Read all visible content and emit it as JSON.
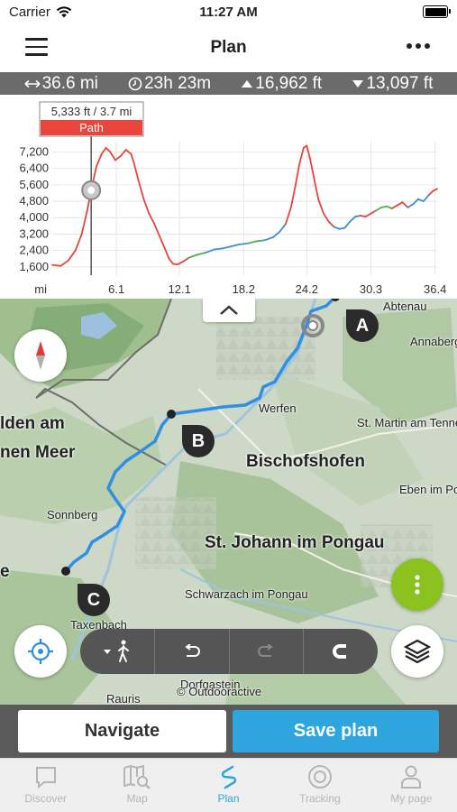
{
  "status": {
    "carrier": "Carrier",
    "time": "11:27 AM"
  },
  "nav": {
    "title": "Plan"
  },
  "stats": {
    "distance": "36.6 mi",
    "duration": "23h 23m",
    "ascent": "16,962 ft",
    "descent": "13,097 ft"
  },
  "chart_data": {
    "type": "line",
    "title": "",
    "xlabel": "mi",
    "ylabel": "ft",
    "xlim": [
      0,
      36.6
    ],
    "ylim": [
      1200,
      7700
    ],
    "x_ticks": [
      "6.1",
      "12.1",
      "18.2",
      "24.2",
      "30.3",
      "36.4"
    ],
    "y_ticks": [
      "7,200",
      "6,400",
      "5,600",
      "4,800",
      "4,000",
      "3,200",
      "2,400",
      "1,600"
    ],
    "series": [
      {
        "x": [
          0,
          0.8,
          1.5,
          2.2,
          2.8,
          3.3,
          3.7,
          4.2,
          4.7,
          5.1,
          5.5,
          6.0,
          6.5,
          7.0,
          7.5,
          7.8,
          8.2,
          8.7,
          9.2,
          9.7,
          10.2,
          10.7,
          11.1,
          11.5,
          11.9,
          12.4,
          13.0,
          13.8,
          14.6,
          15.4,
          16.2,
          17.0,
          17.8,
          18.6,
          19.4,
          20.2,
          21.0,
          21.6,
          22.2,
          22.7,
          23.1,
          23.5,
          23.9,
          24.2,
          24.5,
          24.9,
          25.3,
          25.8,
          26.3,
          26.8,
          27.3,
          27.8,
          28.3,
          28.8,
          29.3,
          29.8,
          30.3,
          30.8,
          31.3,
          31.8,
          32.3,
          32.8,
          33.3,
          33.8,
          34.3,
          34.8,
          35.3,
          35.8,
          36.2,
          36.6
        ],
        "y": [
          1700,
          1650,
          1900,
          2400,
          3200,
          4300,
          5333,
          6500,
          7100,
          7400,
          7200,
          6800,
          7000,
          7300,
          7100,
          6600,
          5800,
          4900,
          4200,
          3700,
          3100,
          2500,
          2000,
          1750,
          1720,
          1850,
          2050,
          2200,
          2300,
          2450,
          2500,
          2600,
          2700,
          2750,
          2850,
          2900,
          3050,
          3300,
          3700,
          4500,
          5500,
          6600,
          7400,
          7500,
          6900,
          5900,
          4900,
          4200,
          3800,
          3550,
          3450,
          3500,
          3800,
          4050,
          4100,
          4050,
          4200,
          4350,
          4500,
          4550,
          4450,
          4600,
          4750,
          4500,
          4650,
          4900,
          4800,
          5100,
          5300,
          5400
        ]
      }
    ],
    "marker": {
      "x": 3.7,
      "y": 5333,
      "label": "5,333 ft / 3.7 mi",
      "segment": "Path"
    },
    "grid": true,
    "colors": {
      "path": "#e8453c",
      "road": "#3b8fd4",
      "trail": "#4caf50"
    }
  },
  "map": {
    "labels": [
      "Abtenau",
      "Annaberg",
      "Werfen",
      "St. Martin am Tenne",
      "Bischofshofen",
      "Eben im Po",
      "Sonnberg",
      "St. Johann im Pongau",
      "Schwarzach im Pongau",
      "Taxenbach",
      "Dorfgastein",
      "Rauris",
      "lden am",
      "nen Meer",
      "e"
    ],
    "waypoints": [
      "A",
      "B",
      "C"
    ],
    "attribution": "© Outdooractive",
    "route_color": "#2f8fe3"
  },
  "toolbar": {
    "activity_icon": "walking-icon"
  },
  "actions": {
    "navigate": "Navigate",
    "save": "Save plan"
  },
  "tabs": [
    {
      "label": "Discover",
      "icon": "chat-bubble-icon"
    },
    {
      "label": "Map",
      "icon": "map-search-icon"
    },
    {
      "label": "Plan",
      "icon": "route-icon",
      "active": true
    },
    {
      "label": "Tracking",
      "icon": "record-icon"
    },
    {
      "label": "My page",
      "icon": "person-icon"
    }
  ]
}
